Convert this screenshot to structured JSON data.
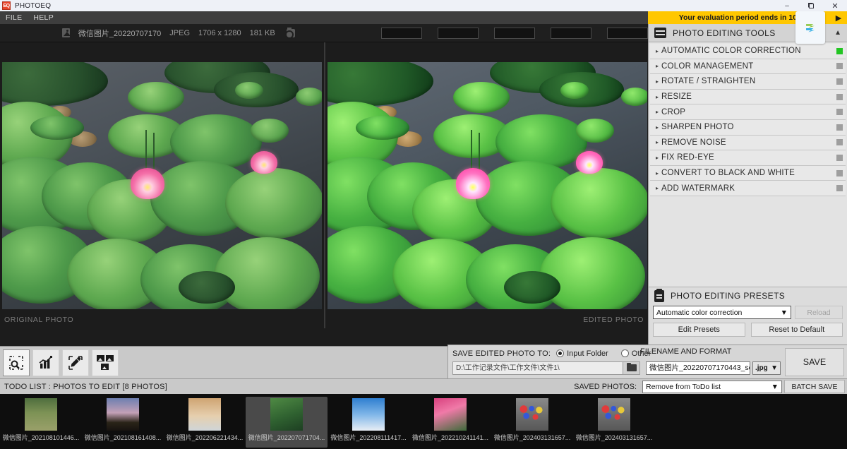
{
  "window": {
    "title": "PHOTOEQ",
    "logo_text": "EQ",
    "minimize": "–",
    "restore": "❐",
    "close": "✕"
  },
  "menu": {
    "items": [
      {
        "label": "FILE"
      },
      {
        "label": "HELP"
      }
    ]
  },
  "eval_banner": {
    "text": "Your evaluation period ends in 10 da",
    "arrow": "▶",
    "bg_color": "#ffc700"
  },
  "image_info": {
    "filename": "微信图片_20220707170",
    "format": "JPEG",
    "dimensions": "1706 x 1280",
    "filesize": "181 KB",
    "top_buttons": [
      "",
      "",
      "",
      "",
      ""
    ]
  },
  "canvas": {
    "original_label": "ORIGINAL PHOTO",
    "edited_label": "EDITED PHOTO"
  },
  "left_toolbar": {
    "buttons": [
      {
        "name": "zoom-select-tool",
        "active": true
      },
      {
        "name": "histogram-tool",
        "active": false
      },
      {
        "name": "eyedropper-tool",
        "active": false
      },
      {
        "name": "compare-view-tool",
        "active": false
      }
    ]
  },
  "tools_panel": {
    "header": "PHOTO EDITING TOOLS",
    "collapse_icon": "▲",
    "items": [
      {
        "label": "AUTOMATIC COLOR CORRECTION",
        "enabled": true
      },
      {
        "label": "COLOR MANAGEMENT",
        "enabled": false
      },
      {
        "label": "ROTATE / STRAIGHTEN",
        "enabled": false
      },
      {
        "label": "RESIZE",
        "enabled": false
      },
      {
        "label": "CROP",
        "enabled": false
      },
      {
        "label": "SHARPEN PHOTO",
        "enabled": false
      },
      {
        "label": "REMOVE NOISE",
        "enabled": false
      },
      {
        "label": "FIX RED-EYE",
        "enabled": false
      },
      {
        "label": "CONVERT TO BLACK AND WHITE",
        "enabled": false
      },
      {
        "label": "ADD WATERMARK",
        "enabled": false
      }
    ],
    "expand_arrow": "▸",
    "enabled_color": "#22c522",
    "disabled_color": "#9e9e9e"
  },
  "presets_panel": {
    "header": "PHOTO EDITING PRESETS",
    "selected": "Automatic color correction",
    "dropdown_arrow": "▼",
    "reload_label": "Reload",
    "edit_label": "Edit Presets",
    "reset_label": "Reset to Default"
  },
  "save_panel": {
    "save_to_label": "SAVE EDITED PHOTO TO:",
    "radio_input_folder": "Input Folder",
    "radio_other": "Other",
    "selected_destination": "Input Folder",
    "path_value": "D:\\工作记录文件\\工作文件\\文件1\\",
    "filename_format_label": "FILENAME AND FORMAT",
    "filename_value": "微信图片_20220707170443_sc",
    "format_value": ".jpg",
    "format_arrow": "▼",
    "save_button": "SAVE"
  },
  "saved_bar": {
    "todo_label": "TODO LIST : PHOTOS TO EDIT   [8 PHOTOS]",
    "saved_photos_label": "SAVED PHOTOS:",
    "saved_action": "Remove from ToDo list",
    "dropdown_arrow": "▼",
    "batch_save": "BATCH SAVE"
  },
  "thumbnails": [
    {
      "label": "微信图片_202108101446...",
      "art": "t-path",
      "selected": false
    },
    {
      "label": "微信图片_202108161408...",
      "art": "t-sunset",
      "selected": false
    },
    {
      "label": "微信图片_202206221434...",
      "art": "t-cat",
      "selected": false
    },
    {
      "label": "微信图片_202207071704...",
      "art": "t-lotus",
      "selected": true
    },
    {
      "label": "微信图片_202208111417...",
      "art": "t-sky",
      "selected": false
    },
    {
      "label": "微信图片_202210241141...",
      "art": "t-pink",
      "selected": false
    },
    {
      "label": "微信图片_202403131657...",
      "art": "t-wall",
      "selected": false
    },
    {
      "label": "微信图片_202403131657...",
      "art": "t-wall",
      "selected": false
    }
  ]
}
